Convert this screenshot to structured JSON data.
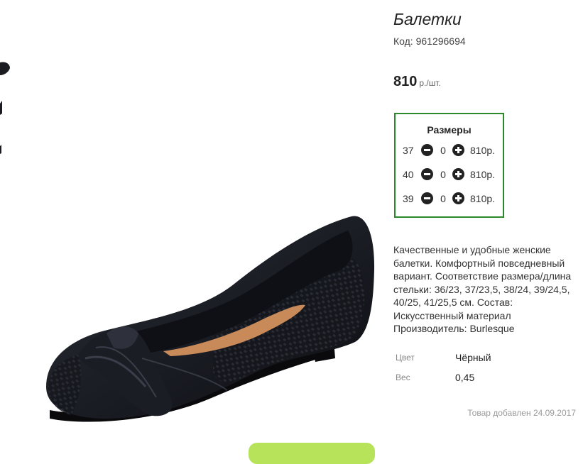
{
  "product": {
    "title": "Балетки",
    "code_label": "Код:",
    "code_value": "961296694",
    "price_value": "810",
    "price_unit": "р./шт."
  },
  "sizes": {
    "title": "Размеры",
    "rows": [
      {
        "size": "37",
        "qty": "0",
        "price": "810р."
      },
      {
        "size": "40",
        "qty": "0",
        "price": "810р."
      },
      {
        "size": "39",
        "qty": "0",
        "price": "810р."
      }
    ]
  },
  "description_lines": [
    "Качественные и удобные женские",
    "балетки. Комфортный повседневный",
    "вариант. Соответствие размера/длина",
    "стельки: 36/23, 37/23,5, 38/24, 39/24,5,",
    "40/25, 41/25,5 см. Состав:",
    "Искусственный материал",
    "Производитель: Burlesque"
  ],
  "properties": [
    {
      "label": "Цвет",
      "value": "Чёрный"
    },
    {
      "label": "Вес",
      "value": "0,45"
    }
  ],
  "added_text": "Товар добавлен 24.09.2017",
  "colors": {
    "sizes_border": "#2a8a2a",
    "cart_button": "#b6e35a",
    "shoe": "#14161c",
    "insole": "#c98a5a"
  },
  "icons": {
    "minus": "minus-circle-icon",
    "plus": "plus-circle-icon"
  }
}
